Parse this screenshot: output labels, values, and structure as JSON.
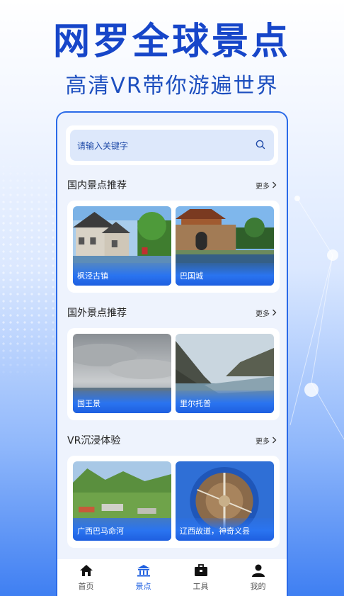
{
  "hero": {
    "title": "网罗全球景点",
    "subtitle": "高清VR带你游遍世界"
  },
  "search": {
    "placeholder": "请输入关键字",
    "icon": "search-icon"
  },
  "sections": [
    {
      "title": "国内景点推荐",
      "more": "更多",
      "items": [
        {
          "label": "枫泾古镇",
          "icon": "photo-ancient-town"
        },
        {
          "label": "巴国城",
          "icon": "photo-city-gate"
        }
      ]
    },
    {
      "title": "国外景点推荐",
      "more": "更多",
      "items": [
        {
          "label": "国王景",
          "icon": "photo-cloudy-sky"
        },
        {
          "label": "里尔托普",
          "icon": "photo-fjord"
        }
      ]
    },
    {
      "title": "VR沉浸体验",
      "more": "更多",
      "items": [
        {
          "label": "广西巴马命河",
          "icon": "photo-hills-village"
        },
        {
          "label": "辽西故道，神奇义县",
          "icon": "photo-tiny-planet"
        }
      ]
    }
  ],
  "tabbar": {
    "items": [
      {
        "label": "首页",
        "icon": "home-icon",
        "active": false
      },
      {
        "label": "景点",
        "icon": "landmark-icon",
        "active": true
      },
      {
        "label": "工具",
        "icon": "toolbox-icon",
        "active": false
      },
      {
        "label": "我的",
        "icon": "user-icon",
        "active": false
      }
    ]
  },
  "colors": {
    "brand": "#1746c9",
    "accent": "#1e5fe0",
    "panel_bg": "#eef3fd",
    "search_bg": "#dde8fb"
  }
}
